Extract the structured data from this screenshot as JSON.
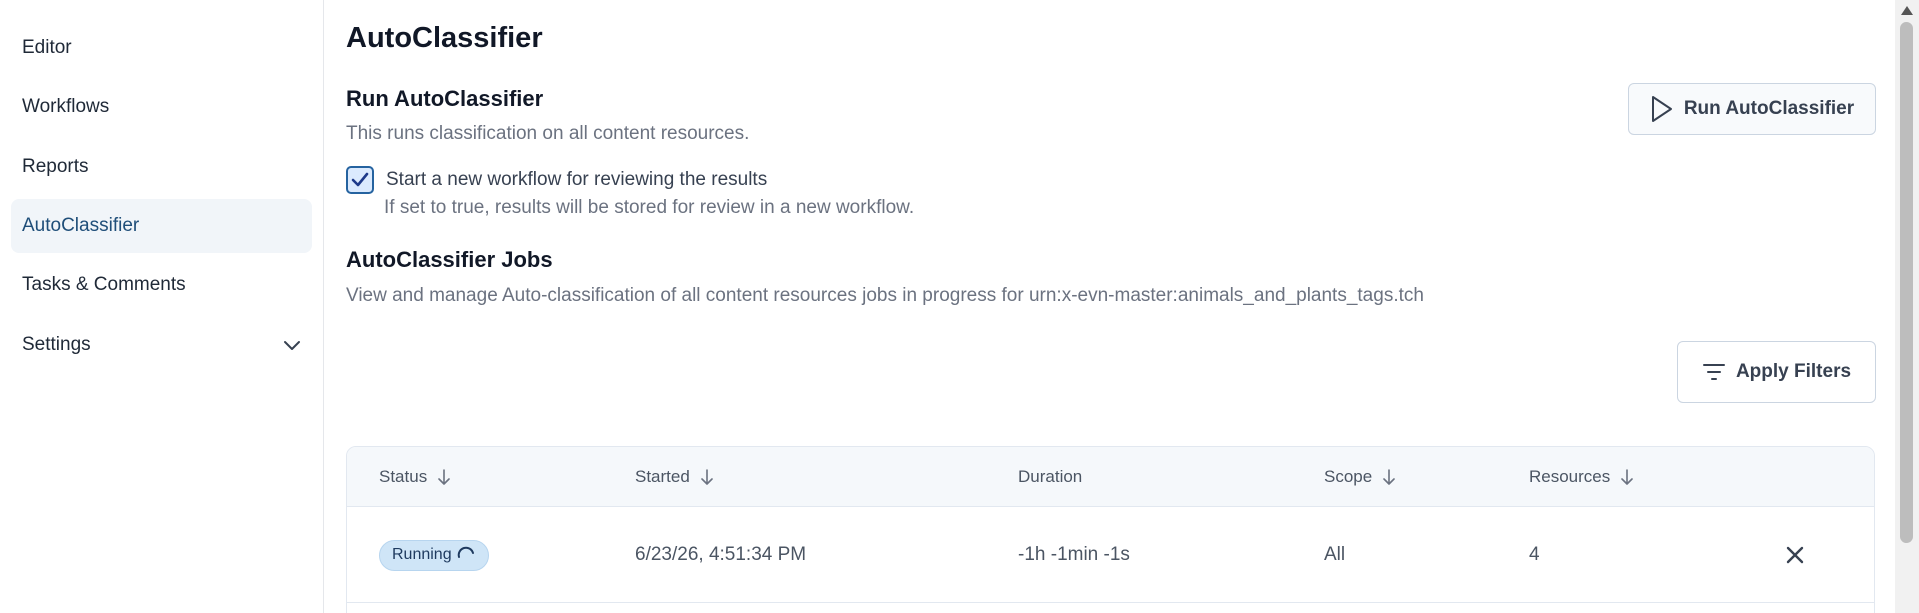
{
  "sidebar": {
    "items": [
      {
        "label": "Editor"
      },
      {
        "label": "Workflows"
      },
      {
        "label": "Reports"
      },
      {
        "label": "AutoClassifier"
      },
      {
        "label": "Tasks & Comments"
      },
      {
        "label": "Settings"
      }
    ],
    "active": "AutoClassifier"
  },
  "main": {
    "title": "AutoClassifier",
    "run": {
      "title": "Run AutoClassifier",
      "description": "This runs classification on all content resources.",
      "button_label": "Run AutoClassifier",
      "checkbox_label": "Start a new workflow for reviewing the results",
      "checkbox_checked": true,
      "checkbox_help": "If set to true, results will be stored for review in a new workflow."
    },
    "jobs": {
      "title": "AutoClassifier Jobs",
      "description": "View and manage Auto-classification of all content resources jobs in progress for urn:x-evn-master:animals_and_plants_tags.tch",
      "filters_label": "Apply Filters"
    },
    "table": {
      "columns": [
        {
          "label": "Status",
          "sortable": true
        },
        {
          "label": "Started",
          "sortable": true
        },
        {
          "label": "Duration",
          "sortable": false
        },
        {
          "label": "Scope",
          "sortable": true
        },
        {
          "label": "Resources",
          "sortable": true
        }
      ],
      "rows": [
        {
          "status": "Running",
          "started": "6/23/26, 4:51:34 PM",
          "duration": "-1h -1min -1s",
          "scope": "All",
          "resources": "4"
        }
      ]
    }
  },
  "colors": {
    "accent": "#1f4e79",
    "active_bg": "#f1f5f9",
    "badge_bg": "#cfe5f7",
    "checkbox_border": "#2563a0"
  },
  "icons": {
    "run": "play-icon",
    "filters": "filter-lines-icon",
    "sort": "arrow-down-icon",
    "cancel": "close-icon",
    "expand": "chevron-down-icon",
    "running": "spinner-icon"
  }
}
